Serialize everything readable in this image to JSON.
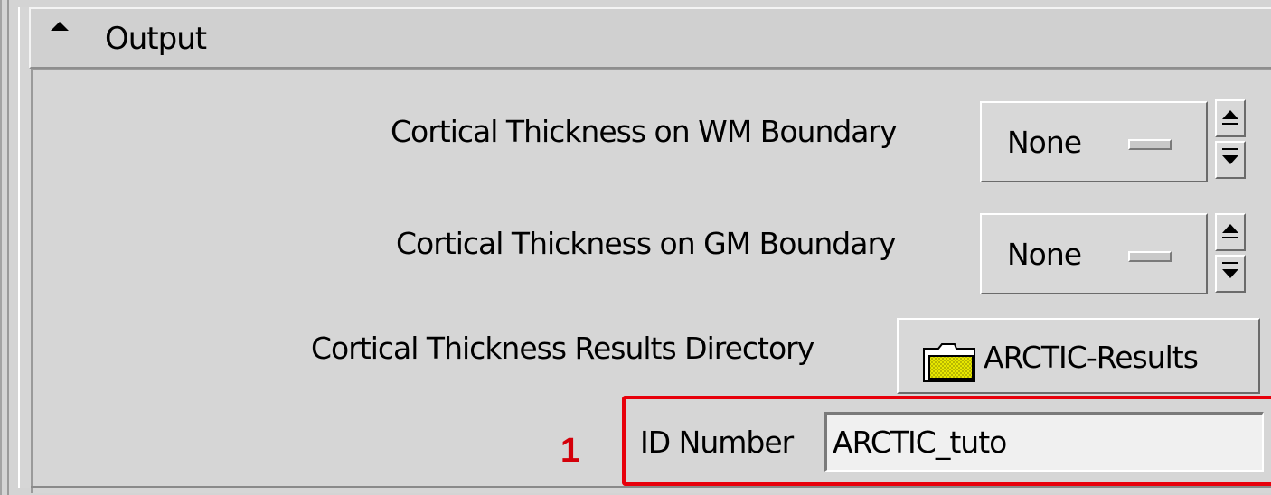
{
  "section": {
    "title": "Output",
    "collapse_icon": "collapse-arrow-icon"
  },
  "fields": [
    {
      "label": "Cortical Thickness on WM Boundary",
      "value": "None"
    },
    {
      "label": "Cortical Thickness on GM Boundary",
      "value": "None"
    }
  ],
  "results_dir": {
    "label": "Cortical Thickness Results Directory",
    "button_text": "ARCTIC-Results",
    "icon": "folder-icon"
  },
  "id_field": {
    "label": "ID Number",
    "value": "ARCTIC_tuto"
  },
  "annotation": {
    "number": "1",
    "color": "#e8000b"
  }
}
